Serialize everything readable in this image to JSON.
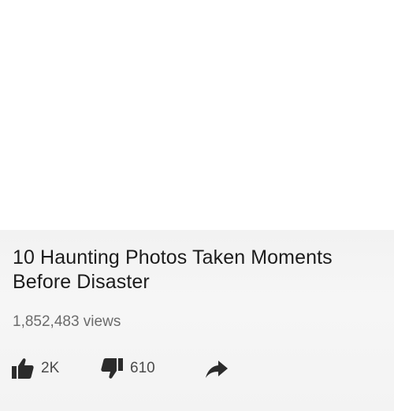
{
  "video": {
    "title": "10 Haunting Photos Taken Moments Before Disaster",
    "views": "1,852,483 views"
  },
  "actions": {
    "like_count": "2K",
    "dislike_count": "610"
  },
  "icons": {
    "like": "thumbs-up-icon",
    "dislike": "thumbs-down-icon",
    "share": "share-arrow-icon"
  },
  "colors": {
    "title": "#1c1c1c",
    "meta": "#6b6b6b",
    "icon": "#2b2b2b",
    "panel": "#f4f4f4"
  }
}
